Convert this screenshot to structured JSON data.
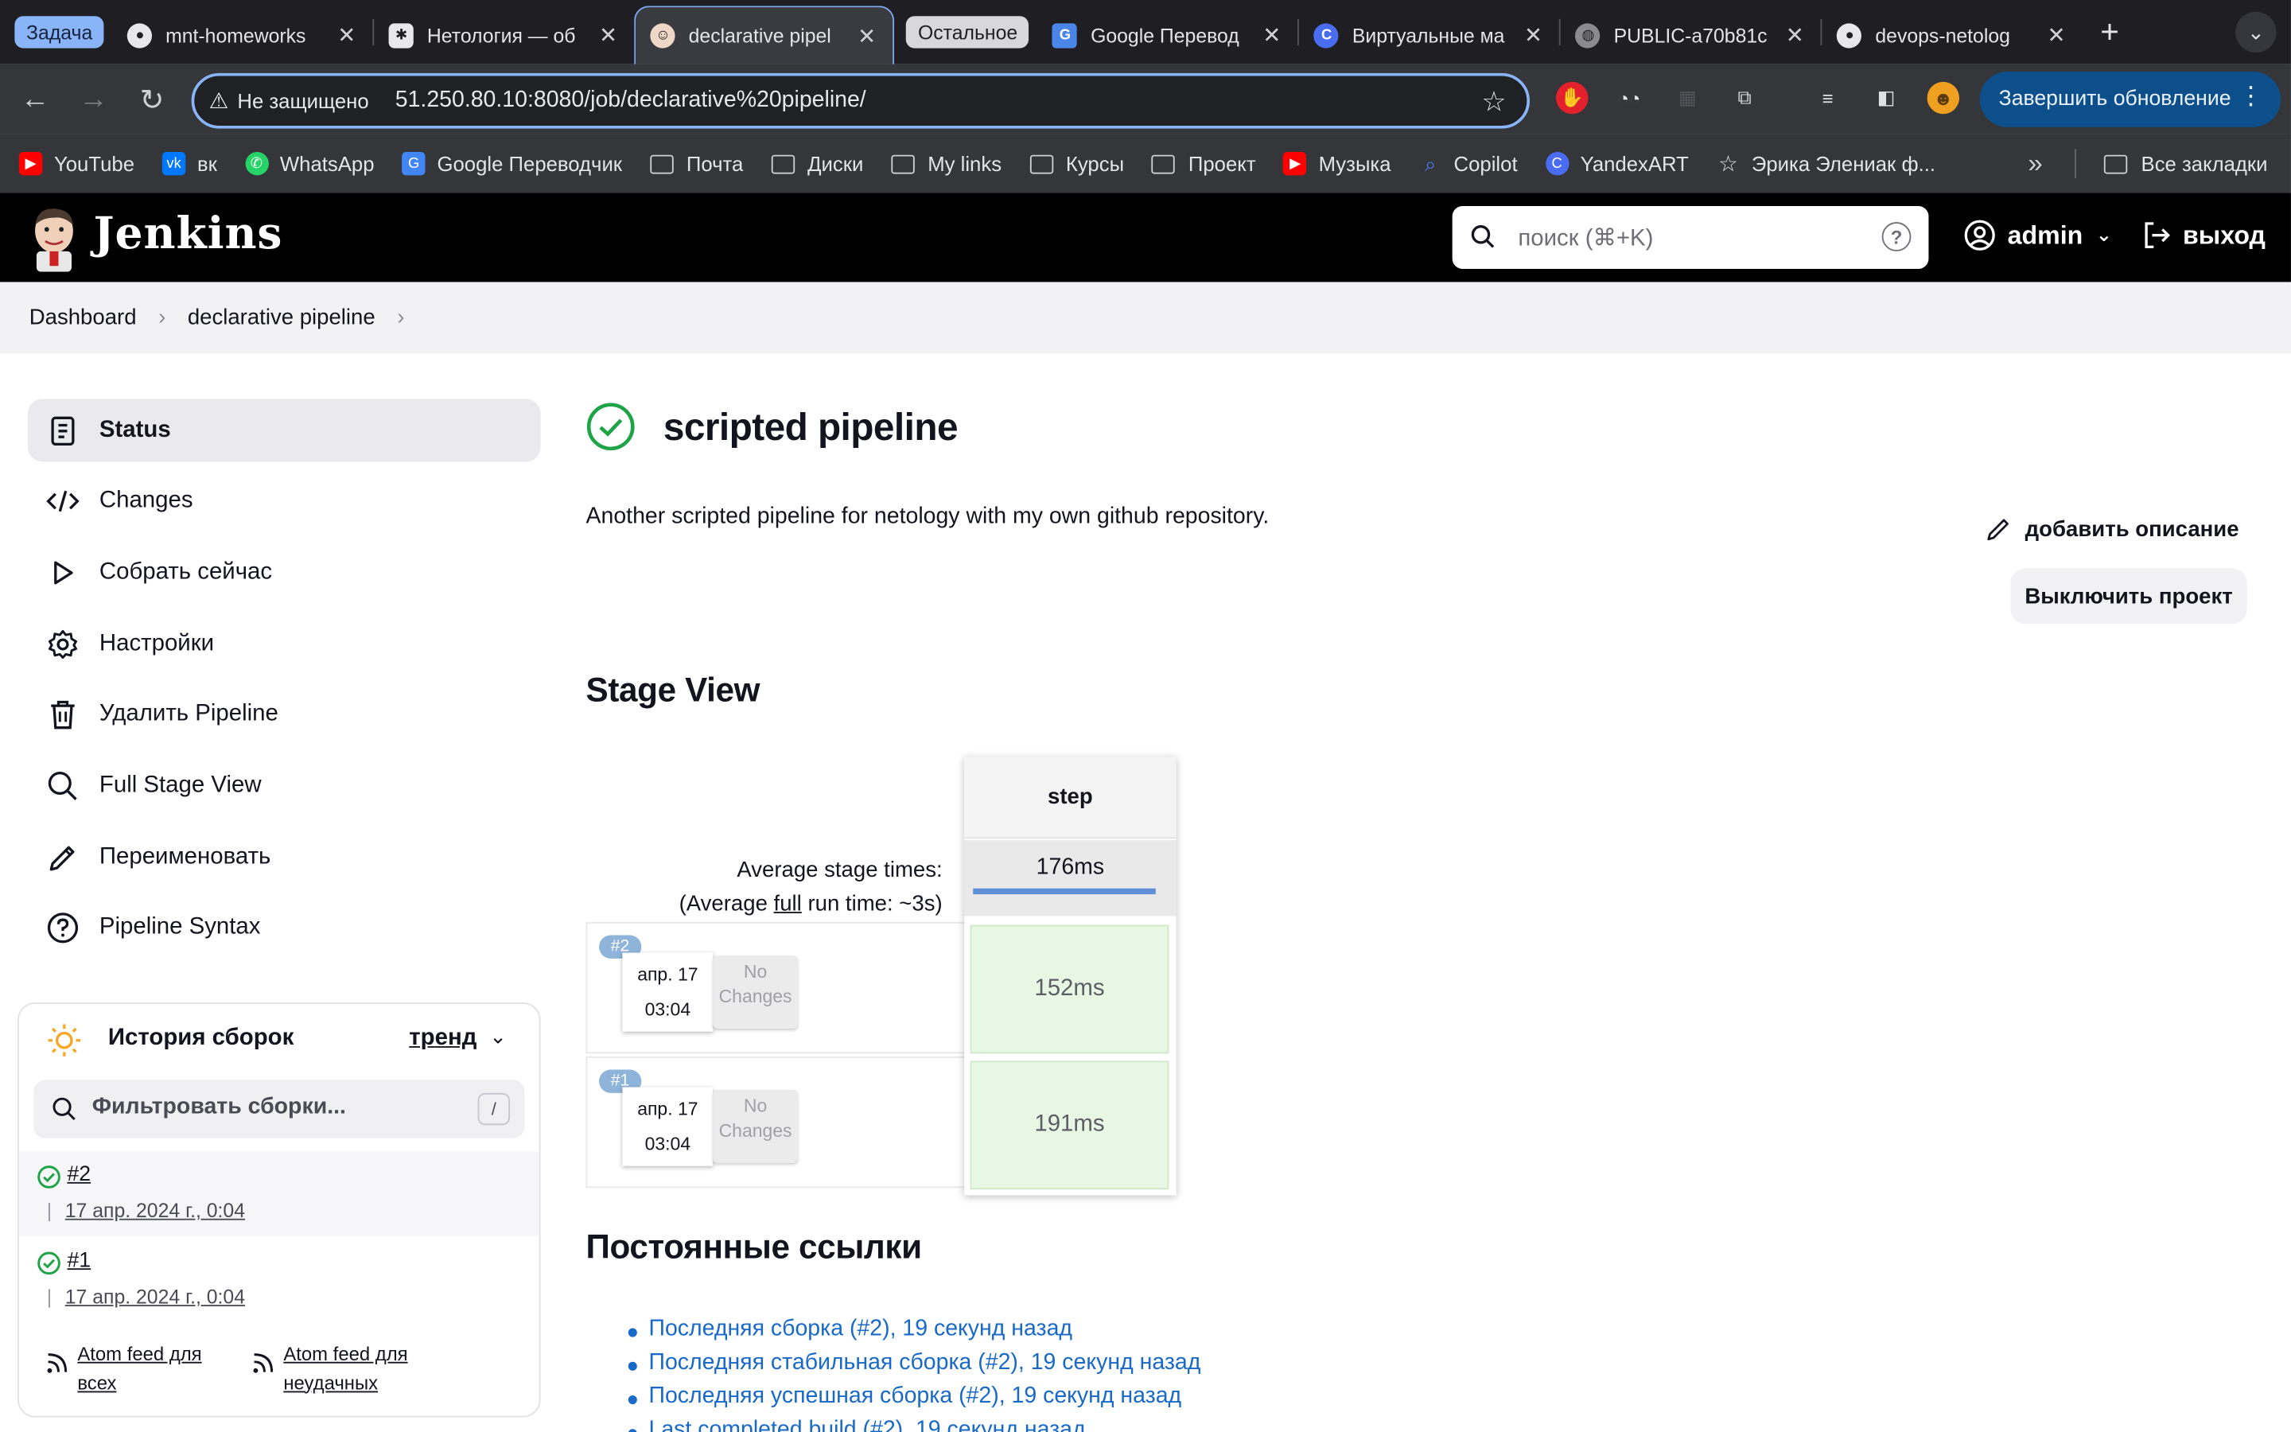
{
  "browser": {
    "tab_group_label": "Задача",
    "tabs": [
      {
        "title": "mnt-homeworks",
        "icon": "github-icon"
      },
      {
        "title": "Нетология — об",
        "icon": "netology-icon"
      },
      {
        "title": "declarative pipel",
        "icon": "jenkins-icon",
        "active": true
      }
    ],
    "tab_group2_label": "Остальное",
    "tabs2": [
      {
        "title": "Google Перевод",
        "icon": "google-translate-icon"
      },
      {
        "title": "Виртуальные ма",
        "icon": "cloud-icon"
      },
      {
        "title": "PUBLIC-a70b81c",
        "icon": "globe-icon"
      },
      {
        "title": "devops-netolog",
        "icon": "github-icon"
      }
    ],
    "security_label": "Не защищено",
    "url": "51.250.80.10:8080/job/declarative%20pipeline/",
    "update_button": "Завершить обновление",
    "bookmarks": [
      {
        "label": "YouTube",
        "icon": "youtube-icon",
        "color": "#ff0000"
      },
      {
        "label": "вк",
        "icon": "vk-icon",
        "color": "#0077ff"
      },
      {
        "label": "WhatsApp",
        "icon": "whatsapp-icon",
        "color": "#25d366"
      },
      {
        "label": "Google Переводчик",
        "icon": "google-translate-icon",
        "color": "#4285f4"
      },
      {
        "label": "Почта",
        "icon": "folder-icon"
      },
      {
        "label": "Диски",
        "icon": "folder-icon"
      },
      {
        "label": "My links",
        "icon": "folder-icon"
      },
      {
        "label": "Курсы",
        "icon": "folder-icon"
      },
      {
        "label": "Проект",
        "icon": "folder-icon"
      },
      {
        "label": "Музыка",
        "icon": "youtube-music-icon",
        "color": "#ff0000"
      },
      {
        "label": "Copilot",
        "icon": "copilot-icon",
        "color": "#4a7cf0"
      },
      {
        "label": "YandexART",
        "icon": "yandexart-icon",
        "color": "#4a6cf0"
      },
      {
        "label": "Эрика Элениак ф...",
        "icon": "star-icon"
      }
    ],
    "all_bookmarks": "Все закладки"
  },
  "jenkins": {
    "brand": "Jenkins",
    "search_placeholder": "поиск (⌘+K)",
    "user": "admin",
    "logout": "выход"
  },
  "breadcrumb": [
    "Dashboard",
    "declarative pipeline"
  ],
  "sidebar": {
    "items": [
      {
        "label": "Status",
        "icon": "status-icon"
      },
      {
        "label": "Changes",
        "icon": "code-icon"
      },
      {
        "label": "Собрать сейчас",
        "icon": "play-icon"
      },
      {
        "label": "Настройки",
        "icon": "gear-icon"
      },
      {
        "label": "Удалить Pipeline",
        "icon": "trash-icon"
      },
      {
        "label": "Full Stage View",
        "icon": "search-icon"
      },
      {
        "label": "Переименовать",
        "icon": "pencil-icon"
      },
      {
        "label": "Pipeline Syntax",
        "icon": "help-icon"
      }
    ]
  },
  "history": {
    "title": "История сборок",
    "trend": "тренд",
    "filter_placeholder": "Фильтровать сборки...",
    "filter_shortcut": "/",
    "builds": [
      {
        "number": "#2",
        "date": "17 апр. 2024 г., 0:04"
      },
      {
        "number": "#1",
        "date": "17 апр. 2024 г., 0:04"
      }
    ],
    "feed_all": "Atom feed для всех",
    "feed_failed": "Atom feed для неудачных"
  },
  "main": {
    "title": "scripted pipeline",
    "description": "Another scripted pipeline for netology with my own github repository.",
    "add_description": "добавить описание",
    "disable_project": "Выключить проект",
    "stage_view_title": "Stage View",
    "avg_stage_label": "Average stage times:",
    "avg_run_prefix": "(Average ",
    "avg_run_full": "full",
    "avg_run_suffix": " run time: ~3s)",
    "stage_name": "step",
    "stage_avg": "176ms",
    "runs": [
      {
        "badge": "#2",
        "date": "апр. 17",
        "time": "03:04",
        "no_changes": "No Changes",
        "duration": "152ms"
      },
      {
        "badge": "#1",
        "date": "апр. 17",
        "time": "03:04",
        "no_changes": "No Changes",
        "duration": "191ms"
      }
    ],
    "permalinks_title": "Постоянные ссылки",
    "permalinks": [
      "Последняя сборка (#2), 19 секунд назад",
      "Последняя стабильная сборка (#2), 19 секунд назад",
      "Последняя успешная сборка (#2), 19 секунд назад",
      "Last completed build (#2), 19 секунд назад"
    ]
  }
}
